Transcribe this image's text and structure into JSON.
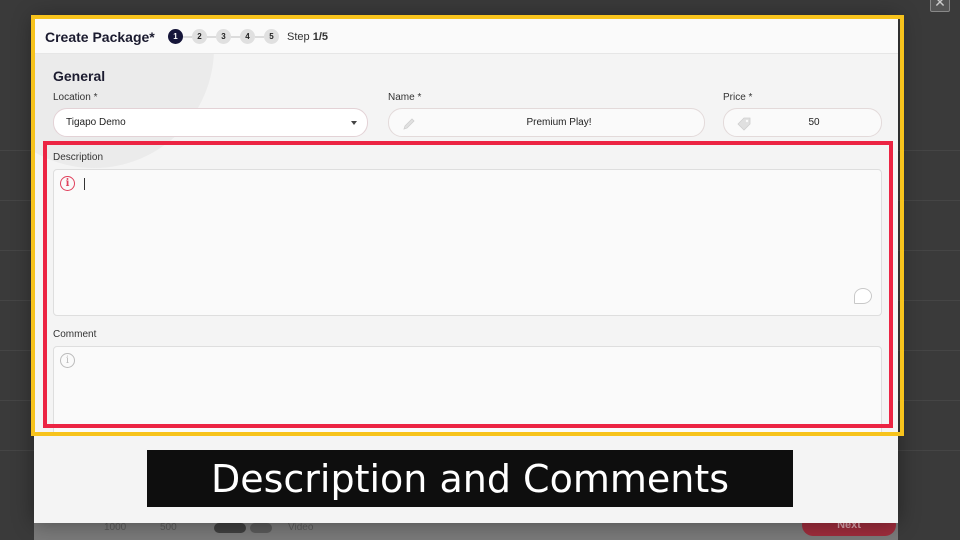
{
  "dialog": {
    "title": "Create Package*",
    "steps": [
      "1",
      "2",
      "3",
      "4",
      "5"
    ],
    "step_prefix": "Step",
    "step_value": "1/5",
    "close_symbol": "✕"
  },
  "form": {
    "section_title": "General",
    "location": {
      "label": "Location *",
      "value": "Tigapo Demo"
    },
    "name": {
      "label": "Name *",
      "value": "Premium Play!"
    },
    "price": {
      "label": "Price *",
      "value": "50"
    },
    "description": {
      "label": "Description"
    },
    "comment": {
      "label": "Comment"
    }
  },
  "footer": {
    "next_label": "Next",
    "col1": "1000",
    "col2": "500",
    "col3": "Video"
  },
  "caption": "Description and Comments",
  "colors": {
    "highlight_outer": "#f7c31c",
    "highlight_inner": "#ec2443",
    "step_active": "#16163a"
  }
}
